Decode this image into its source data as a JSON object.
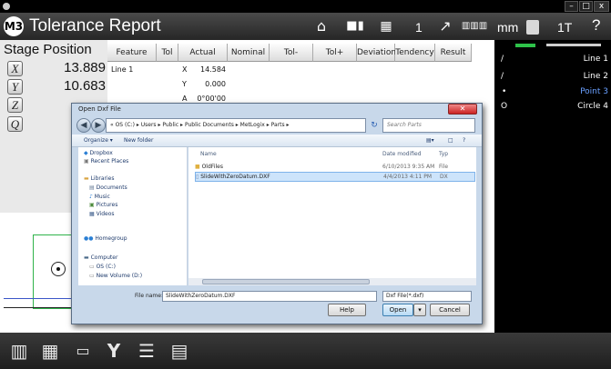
{
  "app": {
    "logo": "M3",
    "title": "Tolerance Report",
    "count": "1",
    "units": "mm",
    "toolbar_label": "1T",
    "help": "?",
    "window_min": "–",
    "window_max": "□",
    "window_close": "x"
  },
  "stage": {
    "title": "Stage Position",
    "x_label": "X",
    "x_value": "13.889",
    "y_label": "Y",
    "y_value": "10.683",
    "z_label": "Z",
    "q_label": "Q"
  },
  "table": {
    "headers": [
      "Feature",
      "Tol",
      "Actual",
      "Nominal",
      "Tol-",
      "Tol+",
      "Deviation",
      "Tendency",
      "Result"
    ],
    "feature": "Line 1",
    "rows": [
      {
        "axis": "X",
        "actual": "14.584"
      },
      {
        "axis": "Y",
        "actual": "0.000"
      },
      {
        "axis": "A",
        "actual": "0°00'00"
      }
    ]
  },
  "features": [
    {
      "icon": "/",
      "label": "Line 1",
      "color": "#ffffff"
    },
    {
      "icon": "/",
      "label": "Line 2",
      "color": "#ffffff"
    },
    {
      "icon": "•",
      "label": "Point 3",
      "color": "#6aa0ff"
    },
    {
      "icon": "O",
      "label": "Circle 4",
      "color": "#ffffff"
    }
  ],
  "dialog": {
    "title": "Open Dxf File",
    "address": "« OS (C:) ▸ Users ▸ Public ▸ Public Documents ▸ MetLogix ▸ Parts ▸",
    "search_placeholder": "Search Parts",
    "organize": "Organize ▾",
    "new_folder": "New folder",
    "nav": {
      "dropbox": "Dropbox",
      "recent": "Recent Places",
      "libraries": "Libraries",
      "documents": "Documents",
      "music": "Music",
      "pictures": "Pictures",
      "videos": "Videos",
      "homegroup": "Homegroup",
      "computer": "Computer",
      "os": "OS (C:)",
      "new_volume": "New Volume (D:)"
    },
    "columns": {
      "name": "Name",
      "date": "Date modified",
      "type": "Typ"
    },
    "files": [
      {
        "name": "OldFiles",
        "date": "6/10/2013 9:35 AM",
        "type": "File"
      },
      {
        "name": "SlideWithZeroDatum.DXF",
        "date": "4/4/2013 4:11 PM",
        "type": "DX"
      }
    ],
    "filename_label": "File name:",
    "filename_value": "SlideWithZeroDatum.DXF",
    "filter": "Dxf File(*.dxf)",
    "help_button": "Help",
    "open_button": "Open",
    "cancel_button": "Cancel"
  }
}
